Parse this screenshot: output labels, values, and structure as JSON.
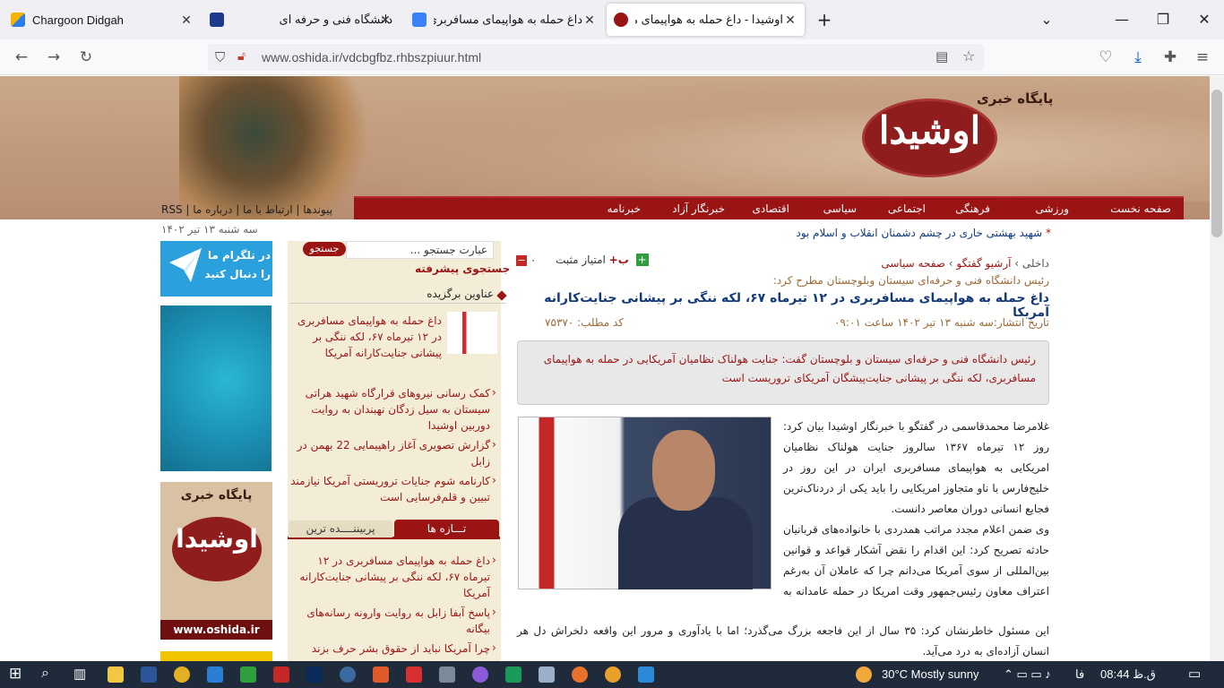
{
  "browser": {
    "tabs": [
      {
        "label": "Chargoon Didgah",
        "color": "#2b7de9"
      },
      {
        "label": "دانشگاه فنی و حرفه ای",
        "color": "#1e3a8a"
      },
      {
        "label": "داغ حمله به هواپیمای مسافربری د",
        "color": "#3b82f6"
      },
      {
        "label": "اوشیدا - داغ حمله به هواپیمای مد",
        "color": "#9a1414"
      }
    ],
    "url": "www.oshida.ir/vdcbgfbz.rhbszpiuur.html",
    "new_tab": "+",
    "close": "✕"
  },
  "site": {
    "logo_sub": "پایگاه خبری",
    "logo_name": "اوشیدا",
    "menu": [
      "صفحه نخست",
      "ورزشی",
      "فرهنگی",
      "اجتماعی",
      "سیاسی",
      "اقتصادی",
      "خبرنگار آزاد",
      "خبرنامه"
    ],
    "toplinks": [
      "RSS",
      "پیوندها",
      "ارتباط با ما",
      "درباره ما"
    ],
    "date": "سه شنبه ۱۳ تیر ۱۴۰۲"
  },
  "left": {
    "telegram_text": "در تلگرام ما را دنبال کنید",
    "ad_logo_title": "پایگاه خبری",
    "ad_logo_name": "اوشیدا",
    "ad_url": "www.oshida.ir"
  },
  "middle": {
    "search_placeholder": "عبارت جستجو ...",
    "search_button": "جستجو",
    "advanced_search": "جستجوی پیشرفته",
    "featured_heading": "عناوین برگزیده",
    "featured": [
      "داغ حمله به هواپیمای مسافربری در ۱۲ تیرماه ۶۷، لکه ننگی بر پیشانی جنایت‌کارانه آمریکا",
      "کمک رسانی نیروهای قرارگاه شهید هراتی سیستان به سیل زدگان نهبندان به روایت دوربین اوشیدا",
      "گزارش تصویری آغاز راهپیمایی 22 بهمن در زابل",
      "کارنامه شوم جنایات تروریستی آمریکا نیازمند تبیین و قلم‌فرسایی است"
    ],
    "tab_new": "تـــازه ها",
    "tab_top": "پربیننــــده ترین",
    "latest": [
      "داغ حمله به هواپیمای مسافربری در ۱۲ تیرماه ۶۷، لکه ننگی بر پیشانی جنایت‌کارانه آمریکا",
      "پاسخ آبفا زابل به روایت وارونه رسانه‌های بیگانه",
      "چرا آمریکا نباید از حقوق بشر حرف بزند"
    ]
  },
  "article": {
    "breaking": "شهید بهشتی خاری در چشم دشمنان انقلاب و اسلام بود",
    "crumb_first": "داخلی",
    "crumb_second": "آرشیو گفتگو",
    "crumb_third": "صفحه سیاسی",
    "score_label": "امتیاز مثبت",
    "score_value": "۰",
    "subtitle": "رئیس دانشگاه فنی و حرفه‌ای سیستان وبلوچستان مطرح کرد:",
    "headline": "داغ حمله به هواپیمای مسافربری در ۱۲ تیرماه ۶۷، لکه ننگی بر پیشانی جنایت‌کارانه آمریکا",
    "pubdate": "تاریخ انتشار:سه شنبه ۱۳ تیر ۱۴۰۲ ساعت ۰۹:۰۱",
    "newscode": "کد مطلب: ۷۵۳۷۰",
    "lead": "رئیس دانشگاه فنی و حرفه‌ای سیستان و بلوچستان گفت: جنایت هولناک نظامیان آمریکایی در حمله به هواپیمای مسافربری، لکه ننگی بر پیشانی جنایت‌پیشگان آمریکای تروریست است",
    "p1": "غلامرضا محمدقاسمی در گفتگو با خبرنگار اوشیدا بیان کرد: روز ۱۲ تیرماه ۱۳۶۷ سالروز جنایت هولناک نظامیان امریکایی به هواپیمای مسافربری ایران در این روز در خلیج‌فارس با ناو متجاوز امریکایی را باید یکی از دردناک‌ترین فجایع انسانی دوران معاصر دانست.",
    "p2": "وی ضمن اعلام مجدد مراتب همدردی با خانواده‌های قربانیان حادثه تصریح کرد: این اقدام را نقض آشکار قواعد و قوانین بین‌المللی از سوی آمریکا می‌دانم چرا که عاملان آن به‌رغم اعتراف معاون رئیس‌جمهور وقت امریکا در حمله عامدانه به هواپیمای مسافربری، نه‌تنها توبیخ نشدند، بلکه توسط رئیس‌جمهور وقت امریکا مدال شجاعت گرفتند.",
    "p3": "این مسئول خاطرنشان کرد: ۳۵ سال از این فاجعه بزرگ می‌گذرد؛ اما با یادآوری و مرور این واقعه دلخراش دل هر انسان آزاده‌ای به درد می‌آید."
  },
  "taskbar": {
    "weather": "30°C  Mostly sunny",
    "lang": "فا",
    "time": "ق.ظ 08:44"
  }
}
